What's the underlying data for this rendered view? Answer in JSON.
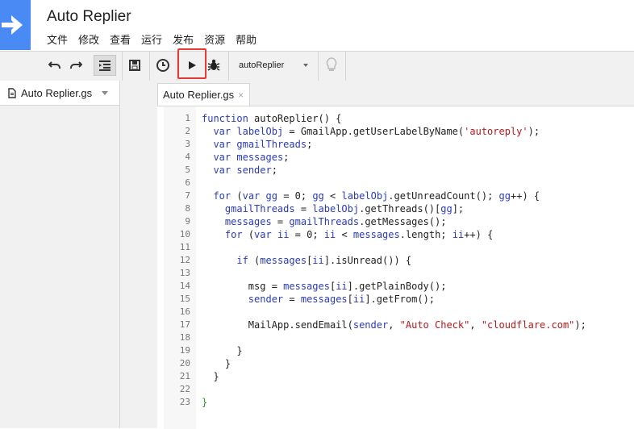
{
  "app": {
    "title": "Auto Replier"
  },
  "menu": [
    "文件",
    "修改",
    "查看",
    "运行",
    "发布",
    "资源",
    "帮助"
  ],
  "toolbar": {
    "function_select": "autoReplier"
  },
  "sidebar": {
    "files": [
      {
        "label": "Auto Replier.gs"
      }
    ]
  },
  "editor": {
    "tab_label": "Auto Replier.gs",
    "tab_close": "×",
    "lines": [
      {
        "n": "1",
        "code": "function autoReplier() {"
      },
      {
        "n": "2",
        "code": "  var labelObj = GmailApp.getUserLabelByName('autoreply');"
      },
      {
        "n": "3",
        "code": "  var gmailThreads;"
      },
      {
        "n": "4",
        "code": "  var messages;"
      },
      {
        "n": "5",
        "code": "  var sender;"
      },
      {
        "n": "6",
        "code": ""
      },
      {
        "n": "7",
        "code": "  for (var gg = 0; gg < labelObj.getUnreadCount(); gg++) {"
      },
      {
        "n": "8",
        "code": "    gmailThreads = labelObj.getThreads()[gg];"
      },
      {
        "n": "9",
        "code": "    messages = gmailThreads.getMessages();"
      },
      {
        "n": "10",
        "code": "    for (var ii = 0; ii < messages.length; ii++) {"
      },
      {
        "n": "11",
        "code": ""
      },
      {
        "n": "12",
        "code": "      if (messages[ii].isUnread()) {"
      },
      {
        "n": "13",
        "code": ""
      },
      {
        "n": "14",
        "code": "        msg = messages[ii].getPlainBody();"
      },
      {
        "n": "15",
        "code": "        sender = messages[ii].getFrom();"
      },
      {
        "n": "16",
        "code": ""
      },
      {
        "n": "17",
        "code": "        MailApp.sendEmail(sender, \"Auto Check\", \"cloudflare.com\");"
      },
      {
        "n": "18",
        "code": ""
      },
      {
        "n": "19",
        "code": "      }"
      },
      {
        "n": "20",
        "code": "    }"
      },
      {
        "n": "21",
        "code": "  }"
      },
      {
        "n": "22",
        "code": ""
      },
      {
        "n": "23",
        "code": "}"
      }
    ]
  },
  "colors": {
    "accent": "#4a8af4",
    "highlight": "#e53935"
  }
}
